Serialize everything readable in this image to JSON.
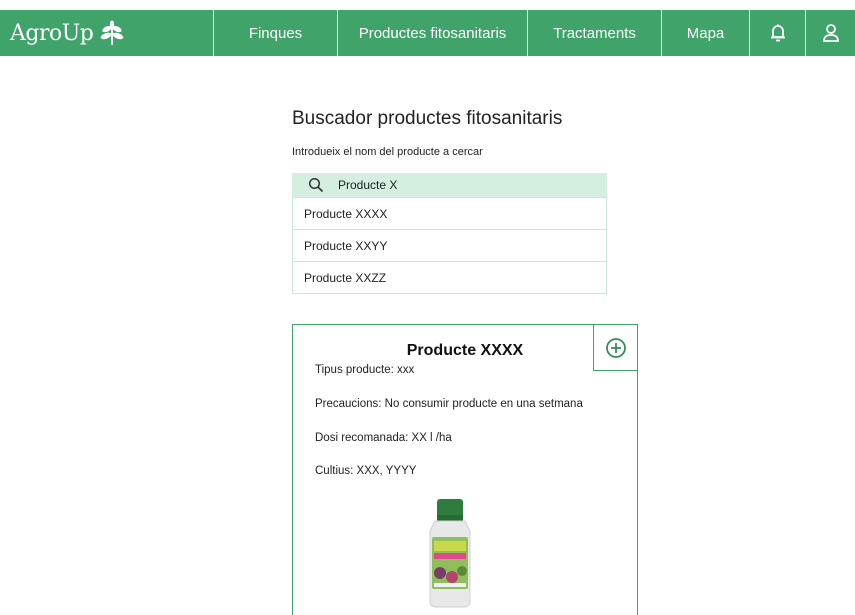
{
  "brand": {
    "name": "AgroUp",
    "icon": "leaf-icon"
  },
  "nav": {
    "items": [
      {
        "label": "Finques"
      },
      {
        "label": "Productes fitosanitaris"
      },
      {
        "label": "Tractaments"
      },
      {
        "label": "Mapa"
      }
    ],
    "bell_icon": "bell-icon",
    "user_icon": "user-icon"
  },
  "page": {
    "title": "Buscador  productes fitosanitaris",
    "subtitle": "Introdueix el nom del producte a cercar"
  },
  "search": {
    "value": "Producte X",
    "icon": "search-icon"
  },
  "results": [
    "Producte XXXX",
    "Producte XXYY",
    "Producte XXZZ"
  ],
  "product": {
    "name": "Producte XXXX",
    "type": "Tipus producte: xxx",
    "precautions": "Precaucions: No consumir producte en una setmana",
    "dose": "Dosi recomanada: XX l /ha",
    "crops": "Cultius: XXX, YYYY",
    "add_icon": "plus-circle-icon",
    "image": "product-bottle-image"
  },
  "colors": {
    "primary": "#3fa36a",
    "search_bg": "#d4efdf",
    "border_light": "#c9e8d6"
  }
}
